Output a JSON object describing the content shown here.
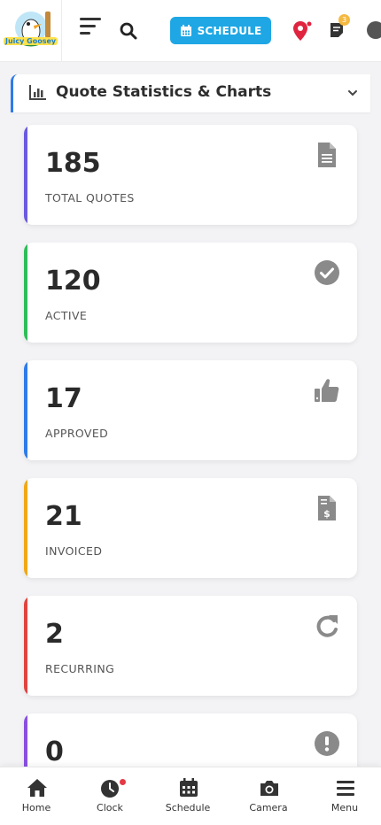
{
  "header": {
    "logo_alt": "Juicy Goosey",
    "schedule_label": "SCHEDULE",
    "notifications_count": "3"
  },
  "section": {
    "title": "Quote Statistics & Charts"
  },
  "stats": [
    {
      "value": "185",
      "label": "TOTAL QUOTES",
      "icon": "document-icon",
      "accent": "#6a5ae0"
    },
    {
      "value": "120",
      "label": "ACTIVE",
      "icon": "check-circle-icon",
      "accent": "#2ebd59"
    },
    {
      "value": "17",
      "label": "APPROVED",
      "icon": "thumbs-up-icon",
      "accent": "#2f7bea"
    },
    {
      "value": "21",
      "label": "INVOICED",
      "icon": "invoice-dollar-icon",
      "accent": "#f0a818"
    },
    {
      "value": "2",
      "label": "RECURRING",
      "icon": "redo-icon",
      "accent": "#e0443f"
    },
    {
      "value": "0",
      "label": "",
      "icon": "exclamation-circle-icon",
      "accent": "#8a4fe0"
    }
  ],
  "bottom_nav": [
    {
      "label": "Home",
      "icon": "home-icon"
    },
    {
      "label": "Clock",
      "icon": "clock-icon"
    },
    {
      "label": "Schedule",
      "icon": "calendar-icon"
    },
    {
      "label": "Camera",
      "icon": "camera-icon"
    },
    {
      "label": "Menu",
      "icon": "menu-icon"
    }
  ],
  "colors": {
    "primary": "#1ea7e4",
    "pin": "#e0243f",
    "icon_gray": "#8a8a8a"
  }
}
